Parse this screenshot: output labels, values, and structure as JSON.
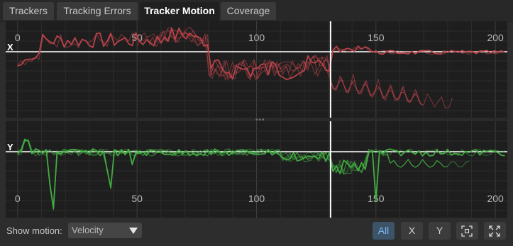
{
  "tabs": [
    {
      "label": "Trackers"
    },
    {
      "label": "Tracking Errors"
    },
    {
      "label": "Tracker Motion",
      "active": true
    },
    {
      "label": "Coverage"
    }
  ],
  "graph": {
    "x_panel_label": "X",
    "y_panel_label": "Y",
    "frame_ticks": [
      "0",
      "50",
      "100",
      "150",
      "200"
    ],
    "frame_range": [
      -5,
      205
    ],
    "current_frame": 131,
    "x_color": "#c0454c",
    "y_color": "#43b043"
  },
  "toolbar": {
    "show_motion_label": "Show motion:",
    "show_motion_value": "Velocity",
    "filter_buttons": [
      "All",
      "X",
      "Y"
    ],
    "active_filter": "All",
    "icons": [
      "frame-selection-icon",
      "expand-icon"
    ]
  }
}
